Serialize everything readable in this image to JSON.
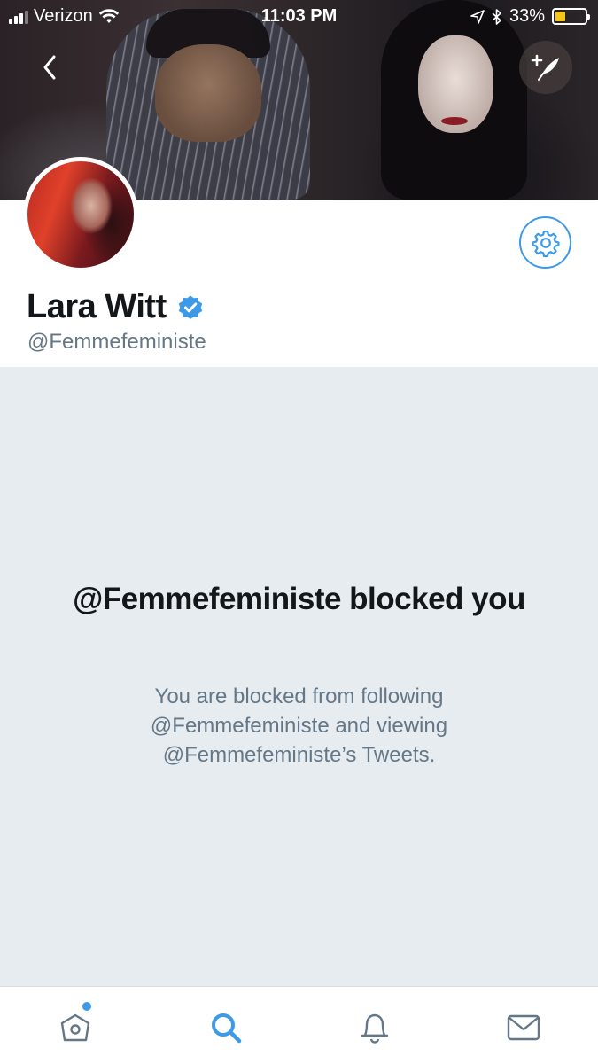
{
  "status_bar": {
    "carrier": "Verizon",
    "time": "11:03 PM",
    "battery_percent": "33%",
    "battery_level": 0.33,
    "icons": [
      "signal-icon",
      "wifi-icon",
      "location-icon",
      "bluetooth-icon",
      "battery-icon"
    ]
  },
  "header": {
    "back_icon": "chevron-left-icon",
    "compose_icon": "compose-tweet-icon"
  },
  "profile": {
    "display_name": "Lara Witt",
    "verified": true,
    "handle": "@Femmefeministe",
    "settings_icon": "gear-icon"
  },
  "blocked": {
    "title": "@Femmefeministe blocked you",
    "body": "You are blocked from following @Femmefeministe and viewing @Femmefeministe’s Tweets."
  },
  "tab_bar": {
    "tabs": [
      {
        "name": "home",
        "icon": "home-icon",
        "has_notification_dot": true
      },
      {
        "name": "search",
        "icon": "search-icon",
        "active": true
      },
      {
        "name": "notifications",
        "icon": "bell-icon"
      },
      {
        "name": "messages",
        "icon": "envelope-icon"
      }
    ]
  },
  "colors": {
    "accent": "#3d9ae8",
    "text_primary": "#14171a",
    "text_secondary": "#657786",
    "panel_background": "#e6ecf0",
    "battery_fill": "#f5c518"
  }
}
